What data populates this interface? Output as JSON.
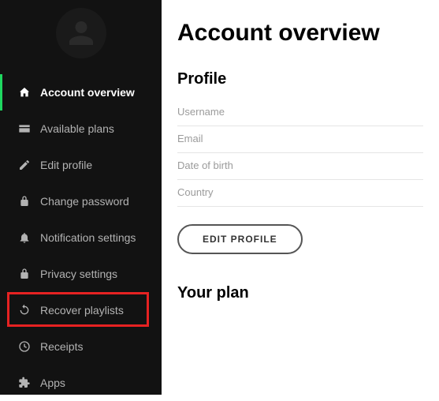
{
  "sidebar": {
    "items": [
      {
        "label": "Account overview"
      },
      {
        "label": "Available plans"
      },
      {
        "label": "Edit profile"
      },
      {
        "label": "Change password"
      },
      {
        "label": "Notification settings"
      },
      {
        "label": "Privacy settings"
      },
      {
        "label": "Recover playlists"
      },
      {
        "label": "Receipts"
      },
      {
        "label": "Apps"
      }
    ]
  },
  "main": {
    "title": "Account overview",
    "profile_heading": "Profile",
    "fields": {
      "username": "Username",
      "email": "Email",
      "dob": "Date of birth",
      "country": "Country"
    },
    "edit_button": "EDIT PROFILE",
    "plan_heading": "Your plan"
  }
}
